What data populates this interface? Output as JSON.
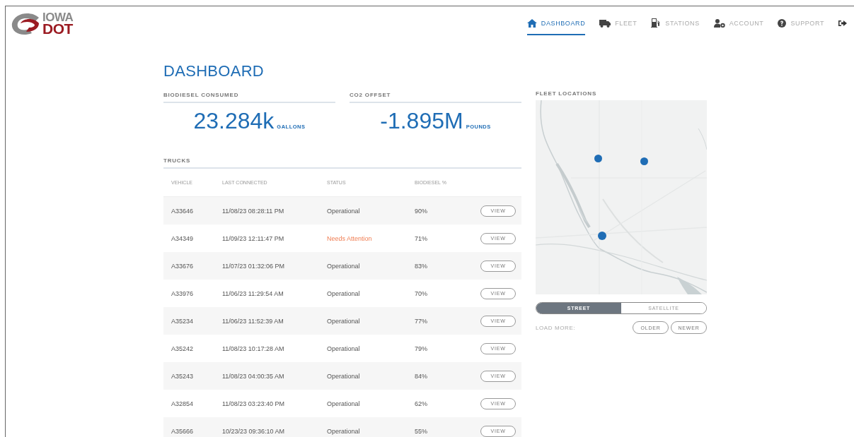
{
  "logo": {
    "line1": "IOWA",
    "line2": "DOT"
  },
  "nav": [
    {
      "label": "DASHBOARD",
      "selected": true
    },
    {
      "label": "FLEET",
      "selected": false
    },
    {
      "label": "STATIONS",
      "selected": false
    },
    {
      "label": "ACCOUNT",
      "selected": false
    },
    {
      "label": "SUPPORT",
      "selected": false
    }
  ],
  "page_title": "DASHBOARD",
  "stats": [
    {
      "label": "BIODIESEL CONSUMED",
      "value": "23.284k",
      "unit": "GALLONS"
    },
    {
      "label": "CO2 OFFSET",
      "value": "-1.895M",
      "unit": "POUNDS"
    }
  ],
  "trucks": {
    "title": "TRUCKS",
    "columns": [
      "VEHICLE",
      "LAST CONNECTED",
      "STATUS",
      "BIODIESEL %"
    ],
    "rows": [
      {
        "vehicle": "A33646",
        "last_connected": "11/08/23 08:28:11 PM",
        "status": "Operational",
        "alert": false,
        "biodiesel": "90%",
        "action": "VIEW"
      },
      {
        "vehicle": "A34349",
        "last_connected": "11/09/23 12:11:47 PM",
        "status": "Needs Attention",
        "alert": true,
        "biodiesel": "71%",
        "action": "VIEW"
      },
      {
        "vehicle": "A33676",
        "last_connected": "11/07/23 01:32:06 PM",
        "status": "Operational",
        "alert": false,
        "biodiesel": "83%",
        "action": "VIEW"
      },
      {
        "vehicle": "A33976",
        "last_connected": "11/06/23 11:29:54 AM",
        "status": "Operational",
        "alert": false,
        "biodiesel": "70%",
        "action": "VIEW"
      },
      {
        "vehicle": "A35234",
        "last_connected": "11/06/23 11:52:39 AM",
        "status": "Operational",
        "alert": false,
        "biodiesel": "77%",
        "action": "VIEW"
      },
      {
        "vehicle": "A35242",
        "last_connected": "11/08/23 10:17:28 AM",
        "status": "Operational",
        "alert": false,
        "biodiesel": "79%",
        "action": "VIEW"
      },
      {
        "vehicle": "A35243",
        "last_connected": "11/08/23 04:00:35 AM",
        "status": "Operational",
        "alert": false,
        "biodiesel": "84%",
        "action": "VIEW"
      },
      {
        "vehicle": "A32854",
        "last_connected": "11/08/23 03:23:40 PM",
        "status": "Operational",
        "alert": false,
        "biodiesel": "62%",
        "action": "VIEW"
      },
      {
        "vehicle": "A35666",
        "last_connected": "10/23/23 09:36:10 AM",
        "status": "Operational",
        "alert": false,
        "biodiesel": "55%",
        "action": "VIEW"
      }
    ]
  },
  "fleet_locations": {
    "title": "FLEET LOCATIONS",
    "map_styles": [
      {
        "label": "STREET",
        "selected": true
      },
      {
        "label": "SATELLITE",
        "selected": false
      }
    ],
    "load_more_label": "LOAD MORE:",
    "load_buttons": [
      "OLDER",
      "NEWER"
    ]
  }
}
